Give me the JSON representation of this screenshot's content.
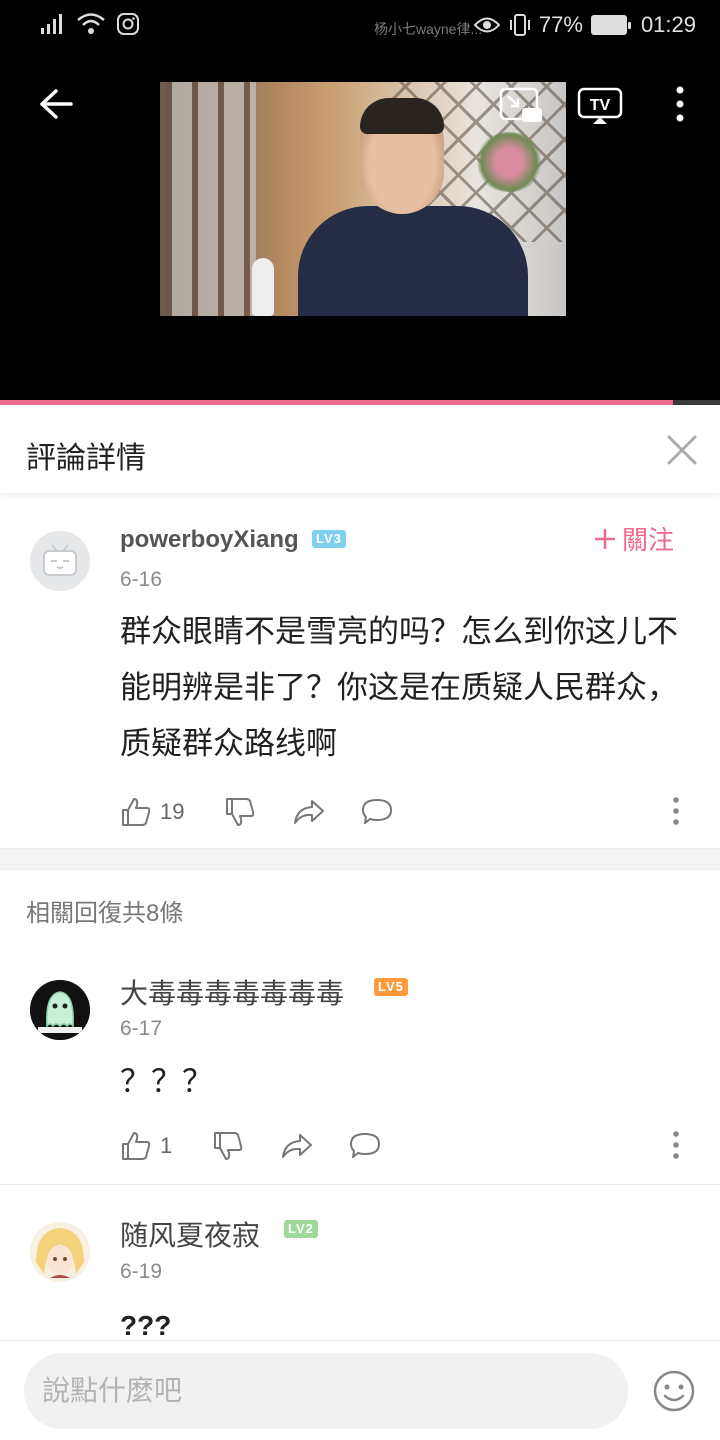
{
  "status_bar": {
    "time": "01:29",
    "battery": "77%",
    "notification_text": "杨小七wayne律..."
  },
  "video": {
    "progress_fraction": 0.935
  },
  "panel": {
    "title": "評論詳情"
  },
  "main_comment": {
    "username": "powerboyXiang",
    "level": "LV3",
    "date": "6-16",
    "follow_label": "關注",
    "text": "群众眼睛不是雪亮的吗？怎么到你这儿不能明辨是非了？你这是在质疑人民群众，质疑群众路线啊",
    "like_count": "19"
  },
  "replies": {
    "header": "相關回復共8條",
    "items": [
      {
        "username": "大毒毒毒毒毒毒毒",
        "level": "LV5",
        "date": "6-17",
        "text": "？？？",
        "like_count": "1"
      },
      {
        "username": "随风夏夜寂",
        "level": "LV2",
        "date": "6-19",
        "text": "???"
      }
    ]
  },
  "input": {
    "placeholder": "說點什麼吧"
  },
  "colors": {
    "accent": "#ee6b89",
    "lv3": "#7fd0ef",
    "lv5": "#ff9a3c",
    "lv2": "#9ed99a"
  },
  "icons": [
    "back-icon",
    "pip-icon",
    "tv-icon",
    "more-vertical-icon",
    "close-icon",
    "plus-icon",
    "like-icon",
    "dislike-icon",
    "share-icon",
    "reply-icon",
    "emoji-icon"
  ]
}
